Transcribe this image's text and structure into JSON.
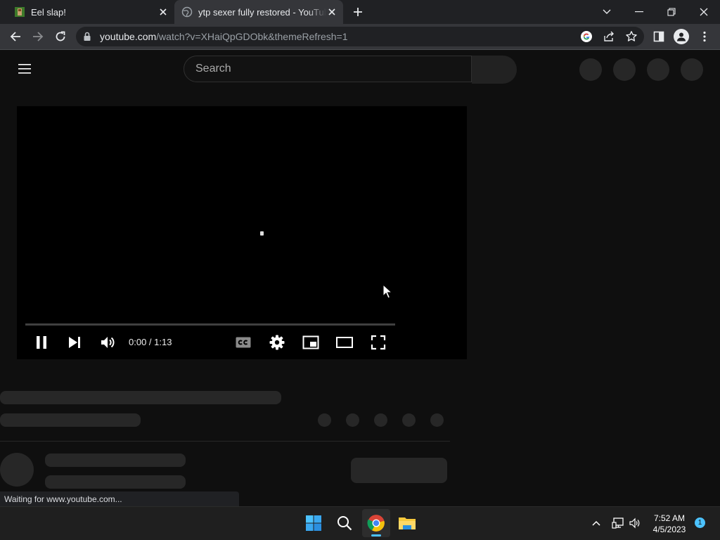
{
  "browser": {
    "tabs": [
      {
        "title": "Eel slap!",
        "favicon": "eel-slap-favicon",
        "active": false
      },
      {
        "title": "ytp sexer fully restored - YouTube",
        "favicon": "globe-icon",
        "active": true
      }
    ],
    "url_host": "youtube.com",
    "url_path": "/watch?v=XHaiQpGDObk&themeRefresh=1",
    "status_text": "Waiting for www.youtube.com..."
  },
  "youtube": {
    "search_placeholder": "Search",
    "player": {
      "time_display": "0:00 / 1:13",
      "progress_fraction": 0,
      "controls": [
        "pause-icon",
        "next-icon",
        "volume-icon",
        "captions-icon",
        "settings-icon",
        "miniplayer-icon",
        "theater-icon",
        "fullscreen-icon"
      ]
    }
  },
  "taskbar": {
    "apps": [
      "windows-start-icon",
      "search-icon",
      "chrome-icon",
      "file-explorer-icon"
    ],
    "clock_time": "7:52 AM",
    "clock_date": "4/5/2023",
    "notification_count": "1"
  },
  "colors": {
    "page_bg": "#0f0f0f",
    "tabstrip_bg": "#202124",
    "toolbar_bg": "#35363a",
    "skeleton": "#272727",
    "accent": "#4cc2ff"
  }
}
